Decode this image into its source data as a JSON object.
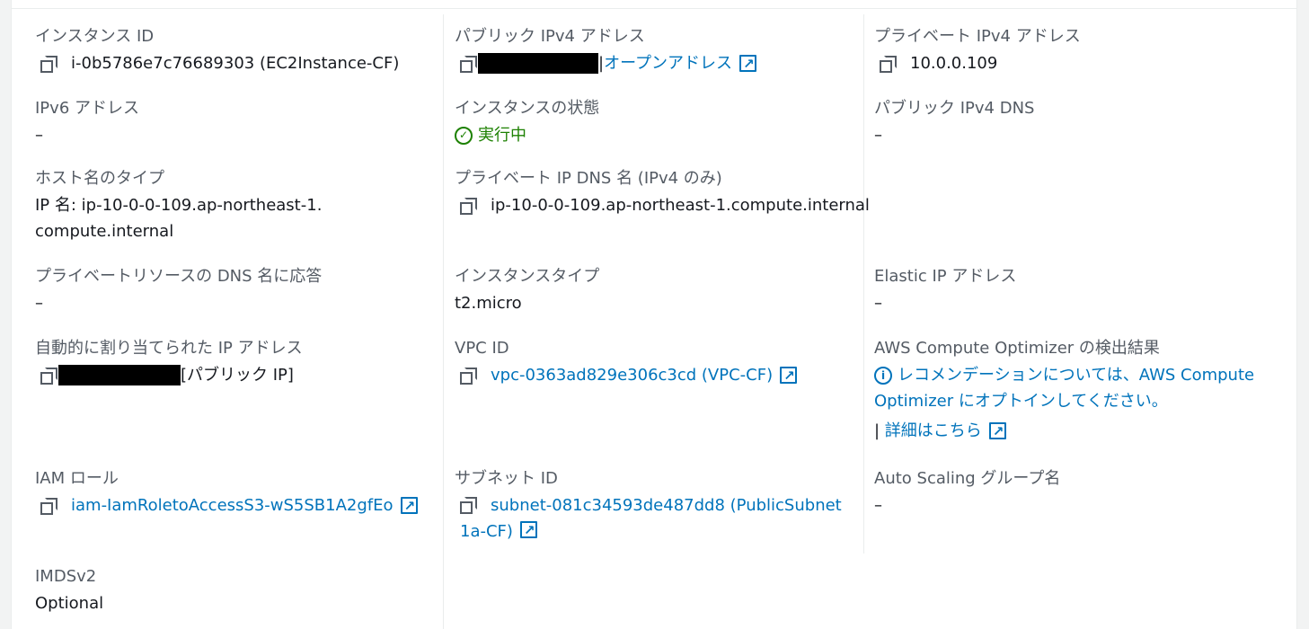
{
  "col1": {
    "instance_id": {
      "label": "インスタンス ID",
      "value": "i-0b5786e7c76689303 (EC2Instance-CF)"
    },
    "ipv6": {
      "label": "IPv6 アドレス",
      "value": "–"
    },
    "hostname_type": {
      "label": "ホスト名のタイプ",
      "value": "IP 名: ip-10-0-0-109.ap-northeast-1.compute.internal"
    },
    "private_resource_dns": {
      "label": "プライベートリソースの DNS 名に応答",
      "value": "–"
    },
    "auto_ip": {
      "label": "自動的に割り当てられた IP アドレス",
      "suffix": "[パブリック IP]"
    },
    "iam_role": {
      "label": "IAM ロール",
      "value": "iam-IamRoletoAccessS3-wS5SB1A2gfEo"
    },
    "imdsv2": {
      "label": "IMDSv2",
      "value": "Optional"
    }
  },
  "col2": {
    "public_ipv4": {
      "label": "パブリック IPv4 アドレス",
      "link": "オープンアドレス"
    },
    "state": {
      "label": "インスタンスの状態",
      "value": "実行中"
    },
    "private_ip_dns": {
      "label": "プライベート IP DNS 名 (IPv4 のみ)",
      "value": "ip-10-0-0-109.ap-northeast-1.compute.internal"
    },
    "instance_type": {
      "label": "インスタンスタイプ",
      "value": "t2.micro"
    },
    "vpc_id": {
      "label": "VPC ID",
      "value": "vpc-0363ad829e306c3cd (VPC-CF)"
    },
    "subnet_id": {
      "label": "サブネット ID",
      "value": "subnet-081c34593de487dd8 (PublicSubnet1a-CF)"
    }
  },
  "col3": {
    "private_ipv4": {
      "label": "プライベート IPv4 アドレス",
      "value": "10.0.0.109"
    },
    "public_ipv4_dns": {
      "label": "パブリック IPv4 DNS",
      "value": "–"
    },
    "elastic_ip": {
      "label": "Elastic IP アドレス",
      "value": "–"
    },
    "compute_optimizer": {
      "label": "AWS Compute Optimizer の検出結果",
      "message": "レコメンデーションについては、AWS Compute Optimizer にオプトインしてください。",
      "learn_more": "詳細はこちら"
    },
    "asg": {
      "label": "Auto Scaling グループ名",
      "value": "–"
    }
  },
  "colors": {
    "link": "#0073bb",
    "success": "#1d8102",
    "label": "#545b64",
    "text": "#16191f"
  }
}
